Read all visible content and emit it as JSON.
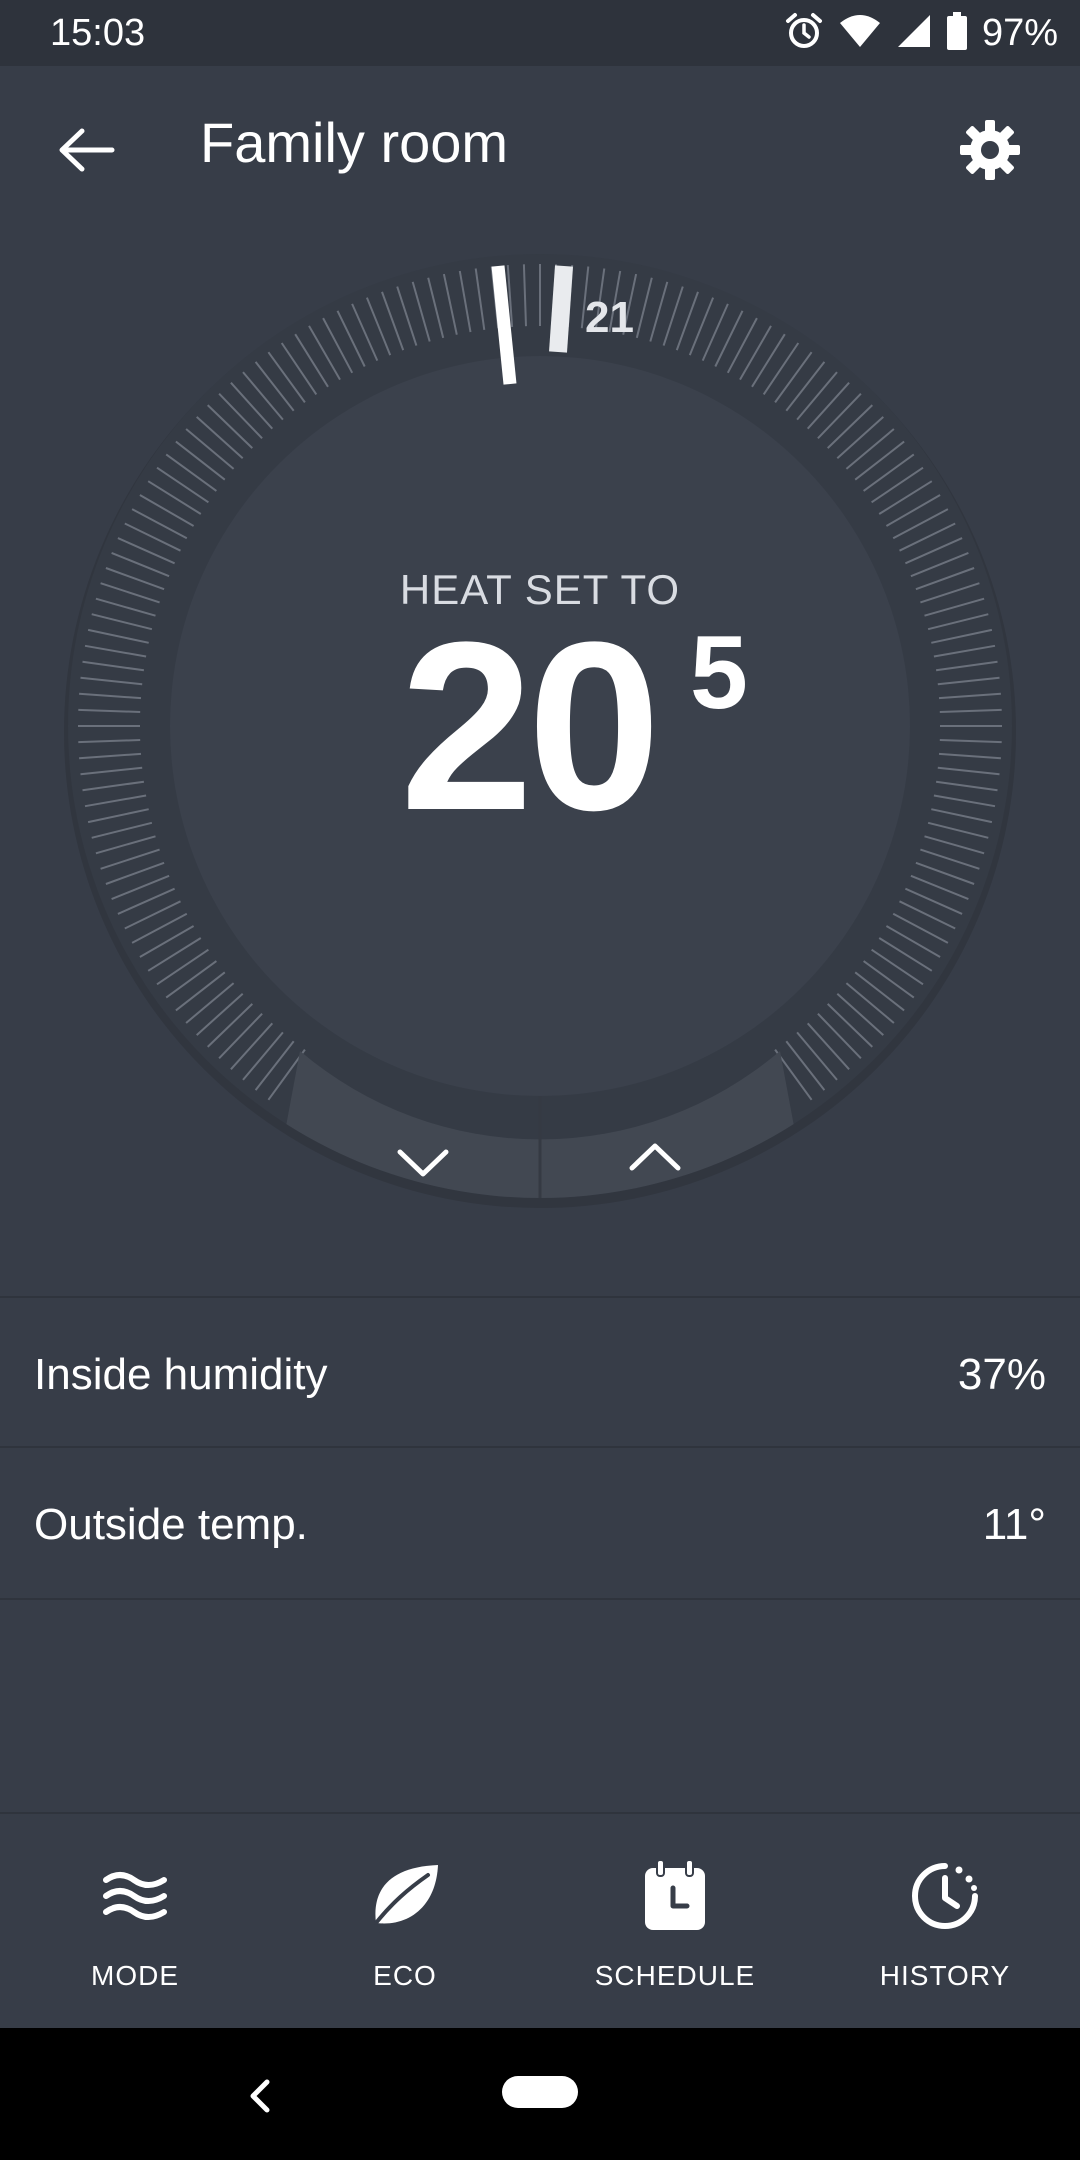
{
  "status_bar": {
    "time": "15:03",
    "battery_percent": "97%",
    "icons": [
      "alarm-icon",
      "wifi-icon",
      "cell-signal-icon",
      "battery-icon"
    ]
  },
  "app_bar": {
    "title": "Family room",
    "back_icon": "arrow-back-icon",
    "settings_icon": "gear-icon"
  },
  "thermostat": {
    "mode_label": "HEAT SET TO",
    "setpoint_whole": "20",
    "setpoint_fraction": "5",
    "current_temp_label": "21",
    "decrease_icon": "chevron-down-icon",
    "increase_icon": "chevron-up-icon",
    "colors": {
      "dial": "#3b414c",
      "dial_ring": "#353b45",
      "ticks": "#6a707b",
      "buttons": "#424852"
    }
  },
  "info": {
    "rows": [
      {
        "label": "Inside humidity",
        "value": "37%"
      },
      {
        "label": "Outside temp.",
        "value": "11°"
      }
    ]
  },
  "bottom_nav": {
    "items": [
      {
        "label": "MODE",
        "icon": "mode-waves-icon"
      },
      {
        "label": "ECO",
        "icon": "leaf-icon"
      },
      {
        "label": "SCHEDULE",
        "icon": "calendar-clock-icon"
      },
      {
        "label": "HISTORY",
        "icon": "history-clock-icon"
      }
    ]
  },
  "system_nav": {
    "back_icon": "system-back-icon",
    "home_icon": "home-pill-icon"
  },
  "theme": {
    "background": "#373d48",
    "status_bar": "#2e333c",
    "text": "#ffffff"
  }
}
